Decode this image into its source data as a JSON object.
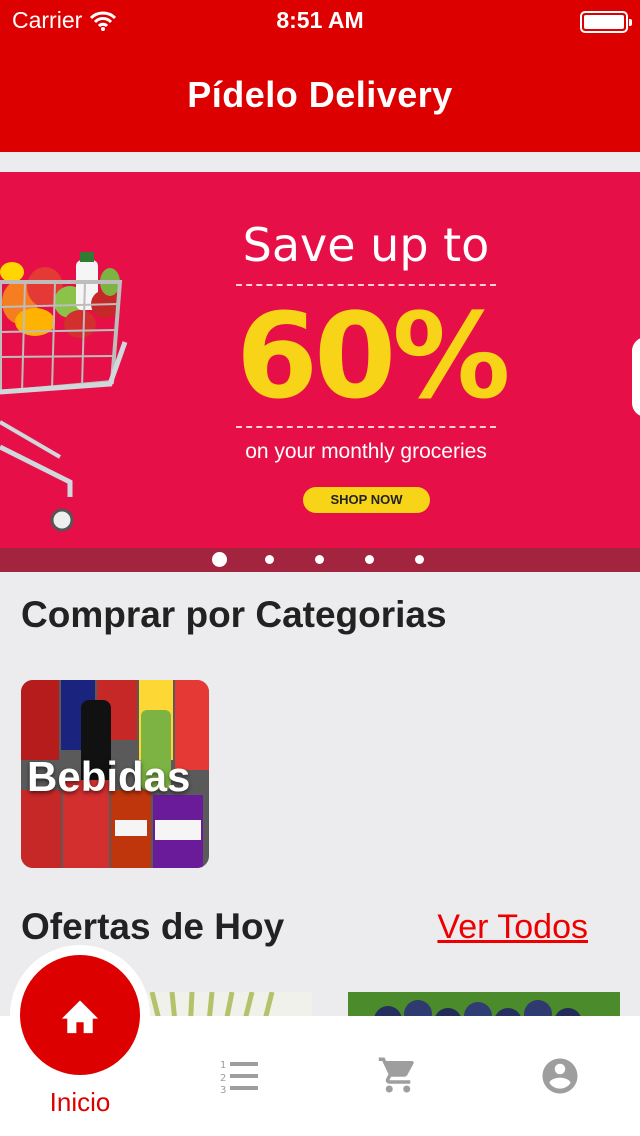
{
  "status_bar": {
    "carrier": "Carrier",
    "time": "8:51 AM"
  },
  "nav": {
    "title": "Pídelo Delivery"
  },
  "banner": {
    "headline": "Save up to",
    "percent": "60%",
    "subline": "on your monthly groceries",
    "cta": "SHOP NOW",
    "slides_total": 5,
    "active_slide": 1
  },
  "categories_section": {
    "title": "Comprar por Categorias",
    "items": [
      {
        "label": "Bebidas"
      }
    ]
  },
  "offers_section": {
    "title": "Ofertas de Hoy",
    "see_all": "Ver Todos"
  },
  "tabbar": {
    "items": [
      {
        "label": "Inicio",
        "icon": "home-icon",
        "active": true
      },
      {
        "label": "",
        "icon": "list-icon",
        "active": false
      },
      {
        "label": "",
        "icon": "cart-icon",
        "active": false
      },
      {
        "label": "",
        "icon": "account-icon",
        "active": false
      }
    ]
  },
  "colors": {
    "brand": "#dd0000",
    "banner_bg": "#e70f47",
    "accent_yellow": "#f7d417",
    "inactive_icon": "#9e9e9e"
  }
}
